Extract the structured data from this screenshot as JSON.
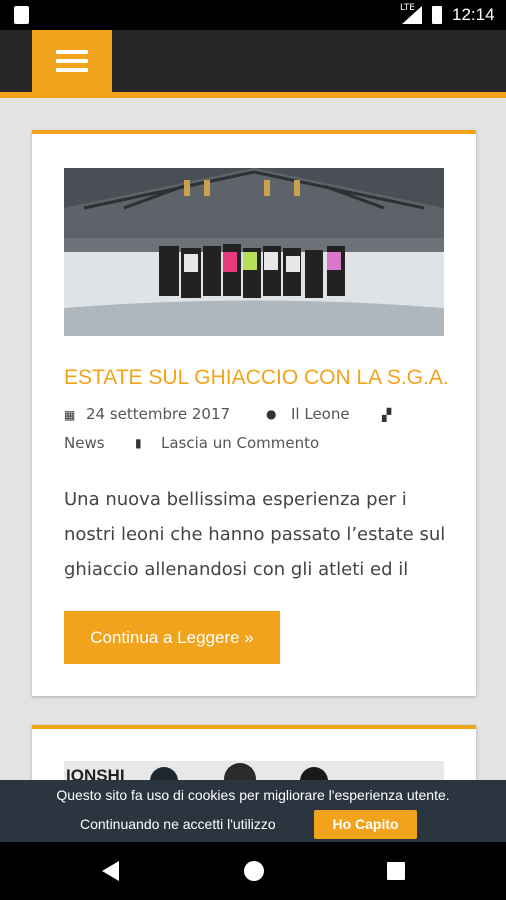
{
  "status_bar": {
    "time": "12:14",
    "network": "LTE"
  },
  "header": {
    "menu_icon": "hamburger-menu-icon"
  },
  "post": {
    "title": "ESTATE SUL GHIACCIO CON LA S.G.A.",
    "date": "24 settembre 2017",
    "author": "Il Leone",
    "category": "News",
    "comment_link": "Lascia un Commento",
    "excerpt": "Una nuova bellissima esperienza per i nostri leoni che hanno passato l’estate sul ghiaccio allenandosi con gli atleti ed il",
    "read_more": "Continua a Leggere »"
  },
  "post2": {
    "banner_text": "IONSHI"
  },
  "cookie_banner": {
    "line1": "Questo sito fa uso di cookies per migliorare l'esperienza utente.",
    "line2": "Continuando ne accetti l'utilizzo",
    "accept_label": "Ho Capito"
  },
  "colors": {
    "accent": "#f0a31b",
    "header_bg": "#262626",
    "cookie_bg": "#2a3540"
  }
}
